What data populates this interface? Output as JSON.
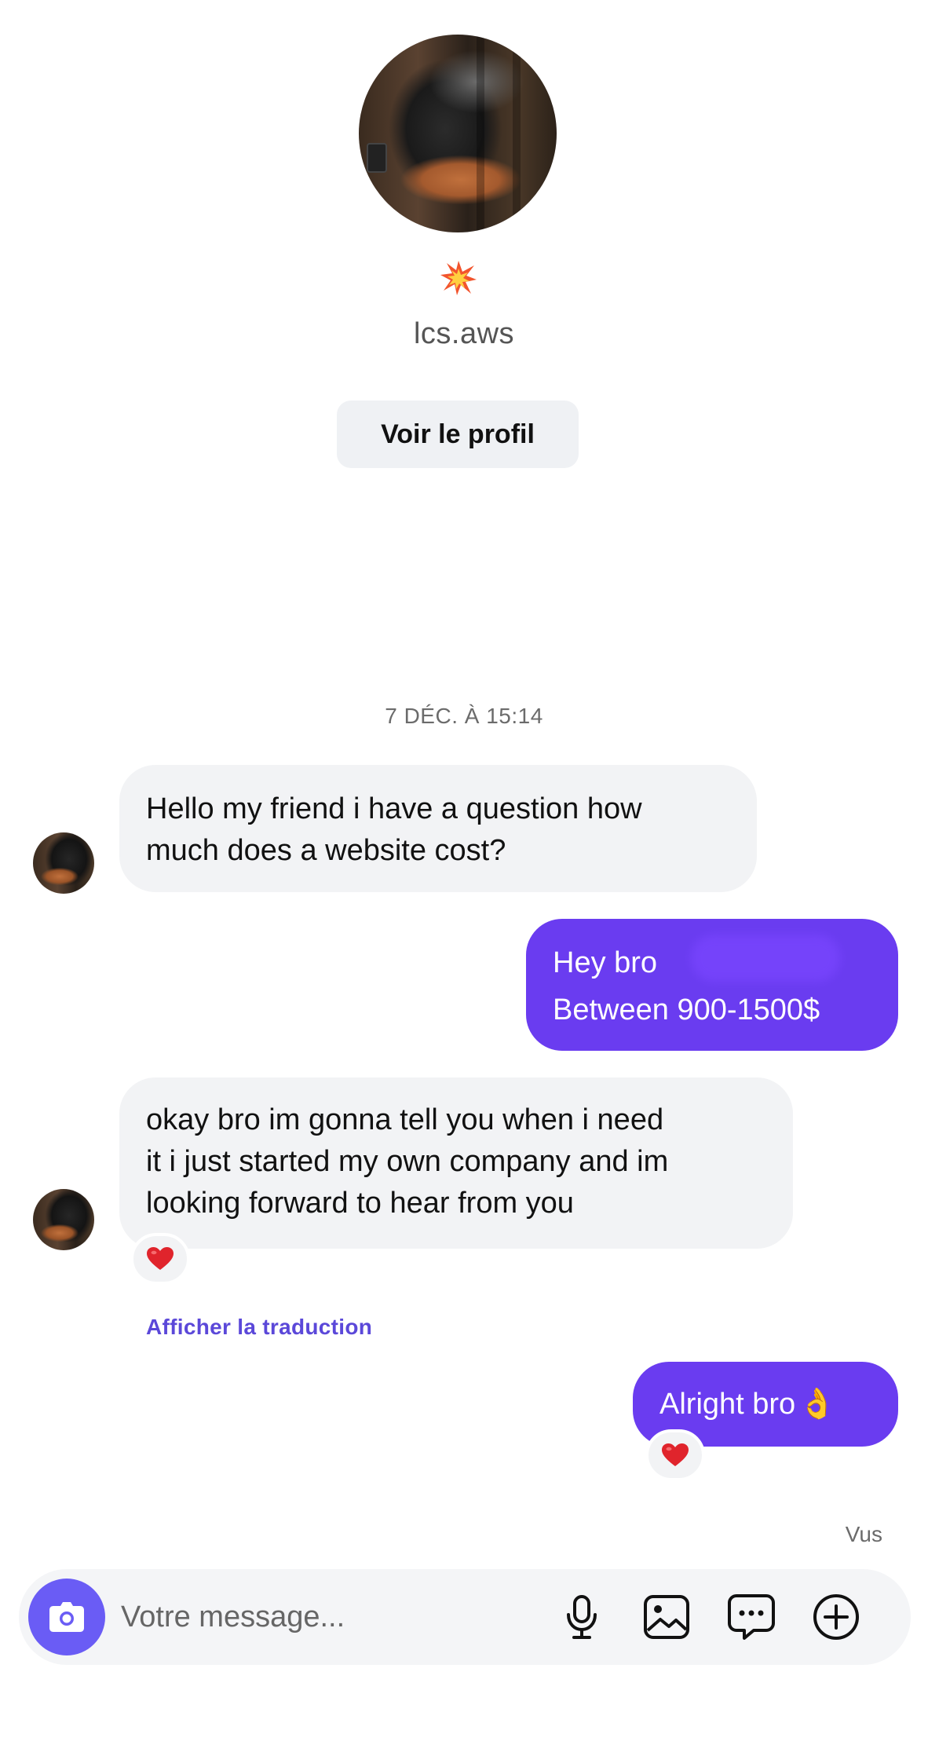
{
  "profile": {
    "username": "lcs.aws",
    "view_profile_label": "Voir le profil"
  },
  "conversation": {
    "timestamp": "7 DÉC. À 15:14",
    "messages": [
      {
        "direction": "incoming",
        "lines": [
          "Hello my friend i have a question how",
          "much does a website cost?"
        ]
      },
      {
        "direction": "outgoing",
        "lines": [
          "Hey bro",
          "Between 900-1500$"
        ]
      },
      {
        "direction": "incoming",
        "lines": [
          "okay bro im gonna tell you when i need",
          "it i just started my own company and im",
          "looking forward to hear from you"
        ],
        "reaction": "heart-icon"
      },
      {
        "direction": "outgoing",
        "text": "Alright bro",
        "emoji": "👌",
        "reaction": "heart-icon"
      }
    ],
    "translate_link": "Afficher la traduction",
    "seen_label": "Vus"
  },
  "composer": {
    "placeholder": "Votre message...",
    "icons": [
      "camera-icon",
      "microphone-icon",
      "image-icon",
      "sticker-icon",
      "plus-icon"
    ]
  },
  "colors": {
    "outgoing_bubble": "#6a3cf0",
    "incoming_bubble": "#f2f3f5",
    "link": "#5b48d9",
    "camera_button": "#6a5cf5",
    "reaction_heart": "#e0242c"
  }
}
